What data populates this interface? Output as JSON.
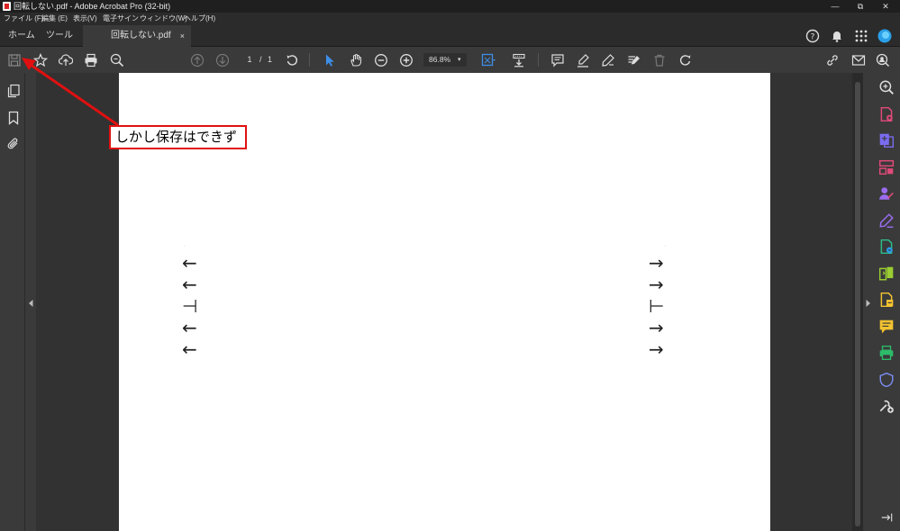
{
  "window": {
    "title": "回転しない.pdf - Adobe Acrobat Pro (32-bit)",
    "minimize": "—",
    "restore": "⧉",
    "close": "✕"
  },
  "menu": [
    "ファイル (F)",
    "編集 (E)",
    "表示(V)",
    "電子サイン",
    "ウィンドウ(W)",
    "ヘルプ(H)"
  ],
  "tabs": {
    "home": "ホーム",
    "tools": "ツール",
    "document": "回転しない.pdf",
    "close": "×"
  },
  "toolbar": {
    "page_current": "1",
    "page_separator": "/",
    "page_total": "1",
    "zoom": "86.8%",
    "zoom_caret": "▾"
  },
  "document": {
    "left_arrows": [
      "←",
      "←",
      "⊣",
      "←",
      "←"
    ],
    "right_arrows": [
      "→",
      "→",
      "⊢",
      "→",
      "→"
    ]
  },
  "annotation": {
    "callout_text": "しかし保存はできず",
    "color": "#e01010"
  },
  "colors": {
    "accent_blue": "#3d8ee8",
    "pink": "#e04a7a",
    "purple": "#9a6cf0",
    "green": "#2dbb6a",
    "yellow": "#f2c230"
  }
}
